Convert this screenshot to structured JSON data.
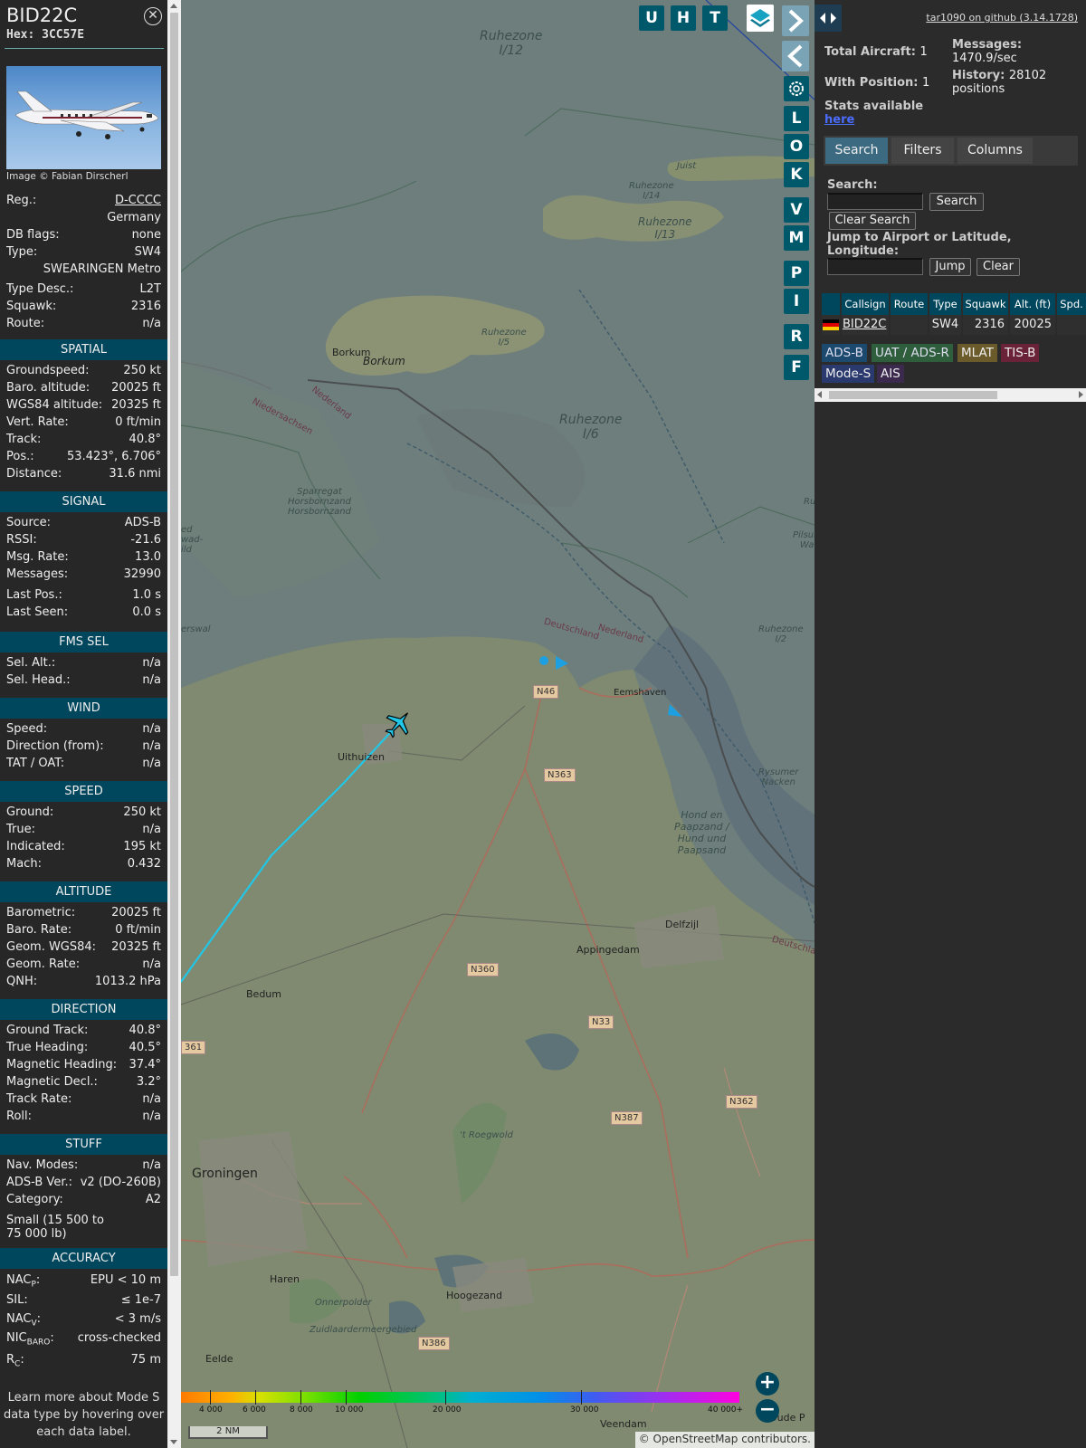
{
  "infoblock": {
    "callsign": "BID22C",
    "hex_label": "Hex:",
    "hex": "3CC57E",
    "photo_credit": "Image © Fabian Dirscherl",
    "general": [
      {
        "label": "Reg.:",
        "value": "D-CCCC"
      },
      {
        "label": "",
        "value": "Germany"
      },
      {
        "label": "DB flags:",
        "value": "none"
      },
      {
        "label": "Type:",
        "value": "SW4"
      },
      {
        "label": "",
        "value": "SWEARINGEN Metro"
      },
      {
        "label": "Type Desc.:",
        "value": "L2T"
      },
      {
        "label": "Squawk:",
        "value": "2316"
      },
      {
        "label": "Route:",
        "value": "n/a"
      }
    ],
    "sections": {
      "spatial": "SPATIAL",
      "signal": "SIGNAL",
      "fms": "FMS SEL",
      "wind": "WIND",
      "speed": "SPEED",
      "altitude": "ALTITUDE",
      "direction": "DIRECTION",
      "stuff": "STUFF",
      "accuracy": "ACCURACY"
    },
    "spatial": [
      {
        "label": "Groundspeed:",
        "value": "250 kt"
      },
      {
        "label": "Baro. altitude:",
        "value": "20025 ft"
      },
      {
        "label": "WGS84 altitude:",
        "value": "20325 ft"
      },
      {
        "label": "Vert. Rate:",
        "value": "0 ft/min"
      },
      {
        "label": "Track:",
        "value": "40.8°"
      },
      {
        "label": "Pos.:",
        "value": "53.423°, 6.706°"
      },
      {
        "label": "Distance:",
        "value": "31.6 nmi"
      }
    ],
    "signal": [
      {
        "label": "Source:",
        "value": "ADS-B"
      },
      {
        "label": "RSSI:",
        "value": "-21.6"
      },
      {
        "label": "Msg. Rate:",
        "value": "13.0"
      },
      {
        "label": "Messages:",
        "value": "32990"
      },
      {
        "label": "Last Pos.:",
        "value": "1.0 s"
      },
      {
        "label": "Last Seen:",
        "value": "0.0 s"
      }
    ],
    "fms": [
      {
        "label": "Sel. Alt.:",
        "value": "n/a"
      },
      {
        "label": "Sel. Head.:",
        "value": "n/a"
      }
    ],
    "wind": [
      {
        "label": "Speed:",
        "value": "n/a"
      },
      {
        "label": "Direction (from):",
        "value": "n/a"
      },
      {
        "label": "TAT / OAT:",
        "value": "n/a"
      }
    ],
    "speed": [
      {
        "label": "Ground:",
        "value": "250 kt"
      },
      {
        "label": "True:",
        "value": "n/a"
      },
      {
        "label": "Indicated:",
        "value": "195 kt"
      },
      {
        "label": "Mach:",
        "value": "0.432"
      }
    ],
    "altitude": [
      {
        "label": "Barometric:",
        "value": "20025 ft"
      },
      {
        "label": "Baro. Rate:",
        "value": "0 ft/min"
      },
      {
        "label": "Geom. WGS84:",
        "value": "20325 ft"
      },
      {
        "label": "Geom. Rate:",
        "value": "n/a"
      },
      {
        "label": "QNH:",
        "value": "1013.2 hPa"
      }
    ],
    "direction": [
      {
        "label": "Ground Track:",
        "value": "40.8°"
      },
      {
        "label": "True Heading:",
        "value": "40.5°"
      },
      {
        "label": "Magnetic Heading:",
        "value": "37.4°"
      },
      {
        "label": "Magnetic Decl.:",
        "value": "3.2°"
      },
      {
        "label": "Track Rate:",
        "value": "n/a"
      },
      {
        "label": "Roll:",
        "value": "n/a"
      }
    ],
    "stuff": [
      {
        "label": "Nav. Modes:",
        "value": "n/a"
      },
      {
        "label": "ADS-B Ver.:",
        "value": "v2 (DO-260B)"
      },
      {
        "label": "Category:",
        "value": "A2"
      }
    ],
    "category_desc": "Small (15 500 to 75 000 lb)",
    "accuracy": [
      {
        "label": "NAC",
        "sub": "P",
        "suffix": ":",
        "value": "EPU < 10 m"
      },
      {
        "label": "SIL:",
        "sub": "",
        "suffix": "",
        "value": "≤ 1e-7"
      },
      {
        "label": "NAC",
        "sub": "V",
        "suffix": ":",
        "value": "< 3 m/s"
      },
      {
        "label": "NIC",
        "sub": "BARO",
        "suffix": ":",
        "value": "cross-checked"
      },
      {
        "label": "R",
        "sub": "C",
        "suffix": ":",
        "value": "75 m"
      }
    ],
    "footnote": "Learn more about Mode S data type by hovering over each data label."
  },
  "map": {
    "buttons": {
      "u": "U",
      "h": "H",
      "t": "T",
      "l": "L",
      "o": "O",
      "k": "K",
      "v": "V",
      "m": "M",
      "p": "P",
      "i": "I",
      "r": "R",
      "f": "F"
    },
    "labels": {
      "ruhezone_i12": "Ruhezone\nI/12",
      "juist": "Juist",
      "ruhezone_i14": "Ruhezone\nI/14",
      "ruhezone_i13": "Ruhezone\nI/13",
      "borkum1": "Borkum",
      "borkum2": "Borkum",
      "ruhezone_i6": "Ruhezone\nI/6",
      "ruhezone_i5": "Ruhezone\nI/5",
      "niedersachsen": "Niedersachsen",
      "nederland1": "Nederland",
      "sparregat": "Sparregat\nHorsbornzand\nHorsbornzand",
      "deutschland1": "Deutschland",
      "nederland2": "Nederland",
      "eemshaven": "Eemshaven",
      "uithuizen": "Uithuizen",
      "hond": "Hond en\nPaapzand /\nHund und\nPaapsand",
      "rysumer": "Rysumer\nNacken",
      "delfzijl": "Delfzijl",
      "appingedam": "Appingedam",
      "bedum": "Bedum",
      "groningen": "Groningen",
      "roegwold": "'t Roegwold",
      "haren": "Haren",
      "hoogezand": "Hoogezand",
      "onnerpolder": "Onnerpolder",
      "zuidlaarder": "Zuidlaardermeergebied",
      "eelde": "Eelde",
      "veendam": "Veendam",
      "oude_pekela": "Oude P",
      "deutschland2": "Deutschlar",
      "ruhezone_i2": "Ruhezone\nI/2",
      "pilsumer": "Pilsume\nWatt",
      "ru_right": "Ru",
      "ewad": "ed\nwad-\nild",
      "erswal": "erswal"
    },
    "roads": {
      "n46": "N46",
      "n363": "N363",
      "n360": "N360",
      "n33": "N33",
      "n387": "N387",
      "n362": "N362",
      "n386": "N386",
      "n361": "361"
    },
    "altitude_scale": [
      "4 000",
      "6 000",
      "8 000",
      "10 000",
      "20 000",
      "30 000",
      "40 000+"
    ],
    "scale_bar": "2 NM",
    "attribution": "© OpenStreetMap contributors."
  },
  "sidebar": {
    "toggle": "◂▸",
    "github_link": "tar1090 on github (3.14.1728)",
    "stats": {
      "total_label": "Total Aircraft:",
      "total": "1",
      "position_label": "With Position:",
      "position": "1",
      "messages_label": "Messages:",
      "messages": "1470.9/sec",
      "history_label": "History:",
      "history": "28102 positions",
      "stats_label": "Stats available",
      "stats_link": "here"
    },
    "tabs": [
      "Search",
      "Filters",
      "Columns"
    ],
    "search_label": "Search:",
    "search_button": "Search",
    "clear_search_button": "Clear Search",
    "jump_label": "Jump to Airport or Latitude, Longitude:",
    "jump_button": "Jump",
    "clear_button": "Clear",
    "table": {
      "headers": [
        "",
        "Callsign",
        "Route",
        "Type",
        "Squawk",
        "Alt. (ft)",
        "Spd."
      ],
      "rows": [
        {
          "flag": "DE",
          "callsign": "BID22C",
          "route": "",
          "type": "SW4",
          "squawk": "2316",
          "alt": "20025",
          "spd": ""
        }
      ]
    },
    "sources": [
      {
        "label": "ADS-B",
        "color": "#1c4a6e",
        "text": "#dde"
      },
      {
        "label": "UAT / ADS-R",
        "color": "#2e5e3b",
        "text": "#dde"
      },
      {
        "label": "MLAT",
        "color": "#6b5a2a",
        "text": "#eee"
      },
      {
        "label": "TIS-B",
        "color": "#6a2238",
        "text": "#eee"
      },
      {
        "label": "Mode-S",
        "color": "#2a3a6e",
        "text": "#eee"
      },
      {
        "label": "AIS",
        "color": "#3c2a4e",
        "text": "#eee"
      }
    ]
  }
}
